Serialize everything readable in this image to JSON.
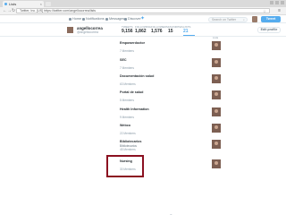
{
  "browser": {
    "tab_title": "Lists",
    "url": "Twitter, Inc. [US]  https://twitter.com/angellocorrea/lists"
  },
  "twitter_nav": {
    "items": [
      {
        "label": "Home"
      },
      {
        "label": "Notifications"
      },
      {
        "label": "Messages"
      },
      {
        "label": "Discover"
      }
    ],
    "search_placeholder": "Search on Twitter",
    "tweet_button": "Tweet"
  },
  "profile": {
    "name": "angellocorrea",
    "handle": "@angellocorrea",
    "edit_button": "Edit profile",
    "stats": [
      {
        "label": "TWEETS",
        "value": "9,156"
      },
      {
        "label": "FOLLOWING",
        "value": "1,862"
      },
      {
        "label": "FOLLOWERS",
        "value": "1,576"
      },
      {
        "label": "FAVORITES",
        "value": "15"
      },
      {
        "label": "LISTS",
        "value": "21"
      }
    ],
    "active_stat_index": 4
  },
  "lists_header": "Lists",
  "lists": [
    {
      "name": "Empowerdoctor",
      "sub": "",
      "members": "7 Members"
    },
    {
      "name": "SEC",
      "sub": "",
      "members": "7 Members"
    },
    {
      "name": "Documentación salud",
      "sub": "",
      "members": "63 Members"
    },
    {
      "name": "Portal de salud",
      "sub": "",
      "members": "5 Members"
    },
    {
      "name": "Health Information",
      "sub": "",
      "members": "9 Members"
    },
    {
      "name": "Webco",
      "sub": "",
      "members": "22 Members"
    },
    {
      "name": "Bibliotecarios",
      "sub": "Bibliotecarios",
      "members": "45 Members"
    },
    {
      "name": "Nursing",
      "sub": "",
      "members": "30 Members"
    }
  ],
  "colors": {
    "twitter_blue": "#55acee",
    "highlight": "#8b1020"
  }
}
